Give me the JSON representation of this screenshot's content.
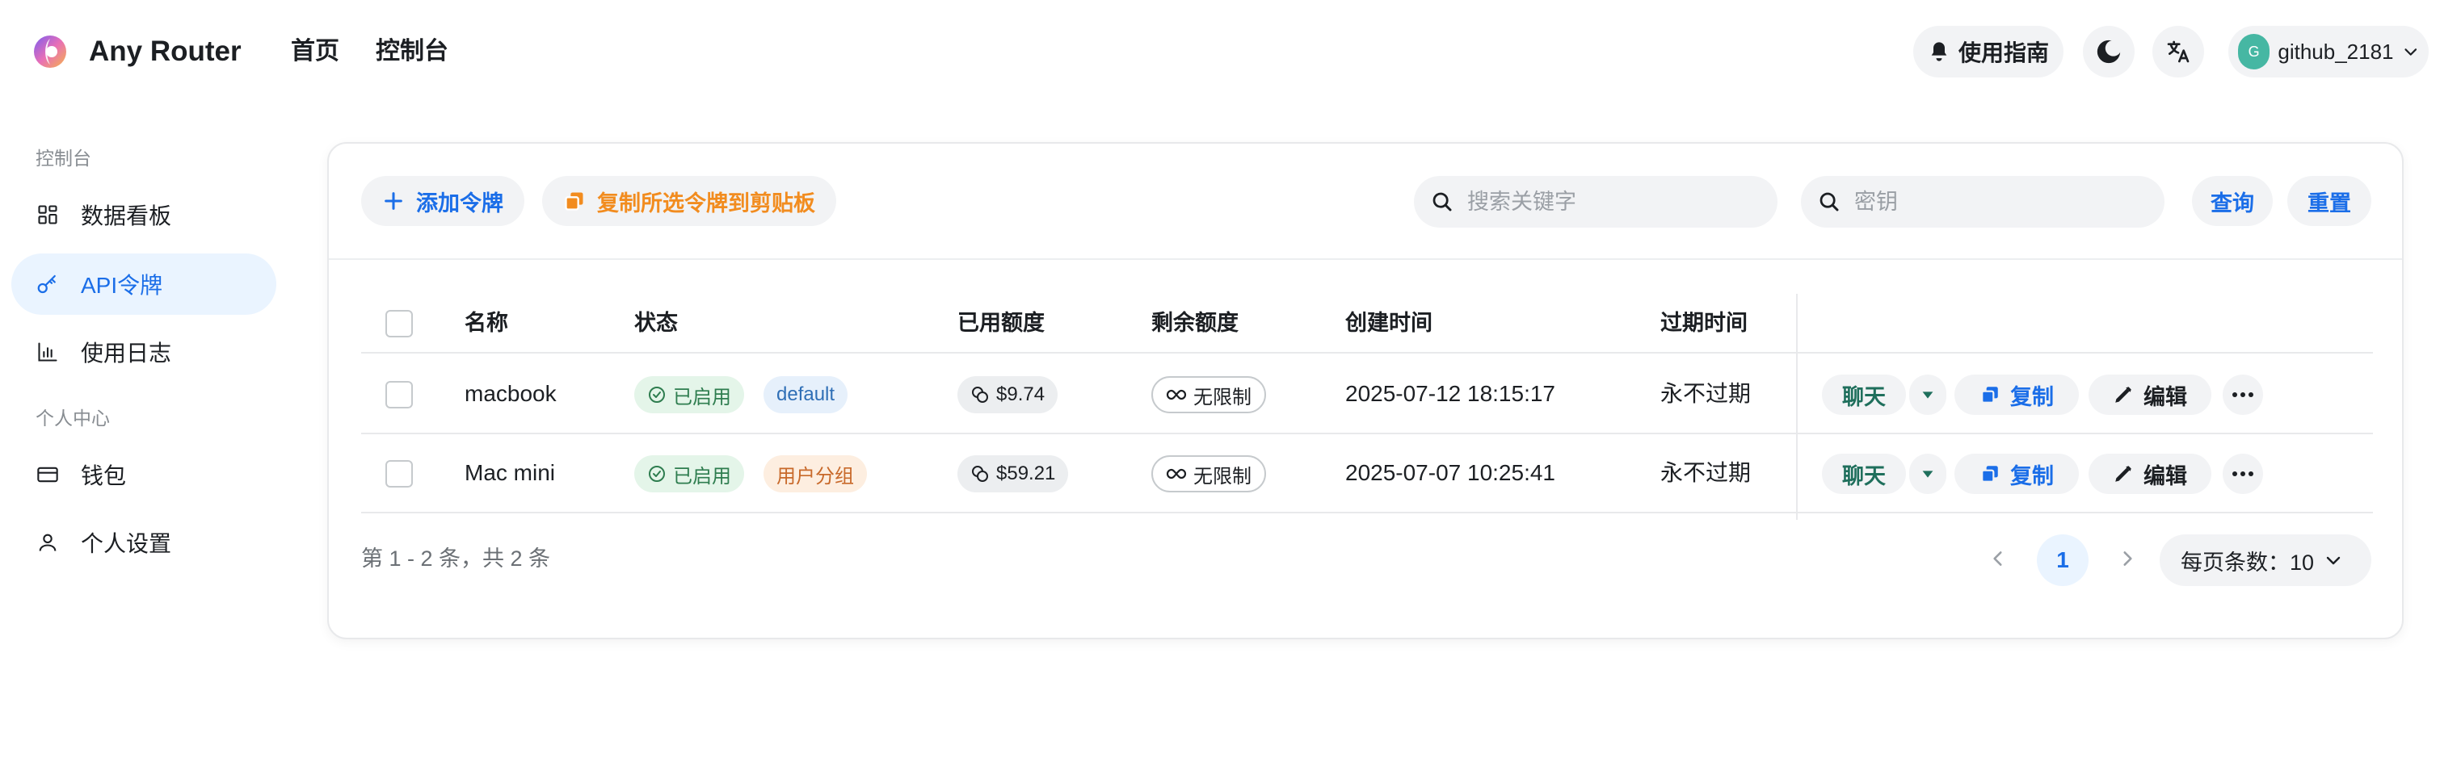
{
  "header": {
    "app_title": "Any Router",
    "nav": [
      "首页",
      "控制台"
    ],
    "guide_label": "使用指南",
    "user": {
      "avatar_letter": "G",
      "name": "github_2181"
    }
  },
  "sidebar": {
    "groups": [
      {
        "label": "控制台",
        "items": [
          {
            "label": "数据看板",
            "icon": "dashboard-icon",
            "active": false
          },
          {
            "label": "API令牌",
            "icon": "key-icon",
            "active": true
          },
          {
            "label": "使用日志",
            "icon": "bar-chart-icon",
            "active": false
          }
        ]
      },
      {
        "label": "个人中心",
        "items": [
          {
            "label": "钱包",
            "icon": "wallet-icon",
            "active": false
          },
          {
            "label": "个人设置",
            "icon": "user-icon",
            "active": false
          }
        ]
      }
    ]
  },
  "toolbar": {
    "add_label": "添加令牌",
    "copy_selected_label": "复制所选令牌到剪贴板",
    "search_keyword_placeholder": "搜索关键字",
    "search_key_placeholder": "密钥",
    "query_label": "查询",
    "reset_label": "重置"
  },
  "table": {
    "columns": [
      "名称",
      "状态",
      "已用额度",
      "剩余额度",
      "创建时间",
      "过期时间"
    ],
    "rows": [
      {
        "name": "macbook",
        "status": "已启用",
        "group": "default",
        "used": "$9.74",
        "remaining": "无限制",
        "created": "2025-07-12 18:15:17",
        "expires": "永不过期"
      },
      {
        "name": "Mac mini",
        "status": "已启用",
        "group": "用户分组",
        "used": "$59.21",
        "remaining": "无限制",
        "created": "2025-07-07 10:25:41",
        "expires": "永不过期"
      }
    ],
    "actions": {
      "chat": "聊天",
      "copy": "复制",
      "edit": "编辑"
    }
  },
  "pagination": {
    "summary": "第 1 - 2 条，共 2 条",
    "current_page": "1",
    "page_size_label": "每页条数：10"
  },
  "colors": {
    "accent": "#1b6ee8",
    "orange": "#f28c1f",
    "green": "#1f6f5c"
  }
}
